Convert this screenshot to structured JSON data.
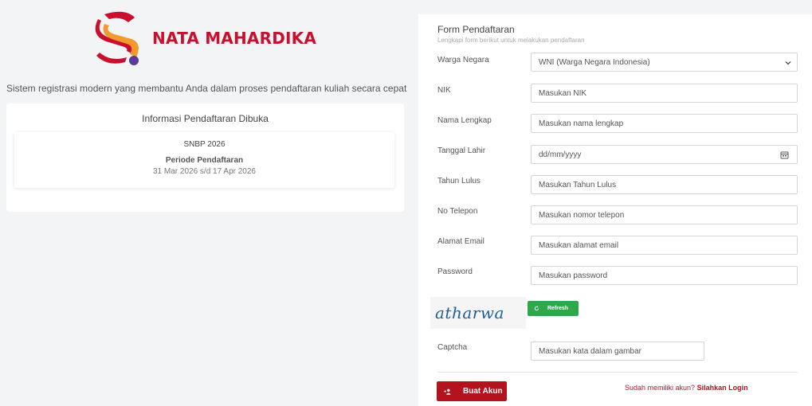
{
  "brand": {
    "name": "NATA MAHARDIKA",
    "tagline": "Sistem registrasi modern yang membantu Anda dalam proses pendaftaran kuliah secara cepat",
    "colors": {
      "primary": "#c8102e",
      "accent_orange": "#f29a2e",
      "accent_purple": "#5b3a9b",
      "success": "#2ea84b"
    }
  },
  "info": {
    "title": "Informasi Pendaftaran Dibuka",
    "program": "SNBP 2026",
    "period_label": "Periode Pendaftaran",
    "period_dates": "31 Mar 2026 s/d 17 Apr 2026"
  },
  "form": {
    "title": "Form Pendaftaran",
    "subtitle": "Lengkapi form berikut untuk melakukan pendaftaran",
    "citizenship": {
      "label": "Warga Negara",
      "value": "WNI (Warga Negara Indonesia)"
    },
    "nik": {
      "label": "NIK",
      "placeholder": "Masukan NIK"
    },
    "full_name": {
      "label": "Nama Lengkap",
      "placeholder": "Masukan nama lengkap"
    },
    "birth_date": {
      "label": "Tanggal Lahir",
      "placeholder": "dd/mm/yyyy"
    },
    "grad_year": {
      "label": "Tahun Lulus",
      "placeholder": "Masukan Tahun Lulus"
    },
    "phone": {
      "label": "No Telepon",
      "placeholder": "Masukan nomor telepon"
    },
    "email": {
      "label": "Alamat Email",
      "placeholder": "Masukan alamat email"
    },
    "password": {
      "label": "Password",
      "placeholder": "Masukan password"
    },
    "captcha": {
      "image_text": "atharwa",
      "refresh_label": "Refresh",
      "label": "Captcha",
      "placeholder": "Masukan kata dalam gambar"
    },
    "submit_label": "Buat Akun",
    "login_prompt": "Sudah memiliki akun?",
    "login_link": "Silahkan Login"
  },
  "icons": {
    "select": "chevron-down-icon",
    "date": "calendar-icon",
    "refresh": "refresh-icon",
    "submit": "user-add-icon"
  }
}
